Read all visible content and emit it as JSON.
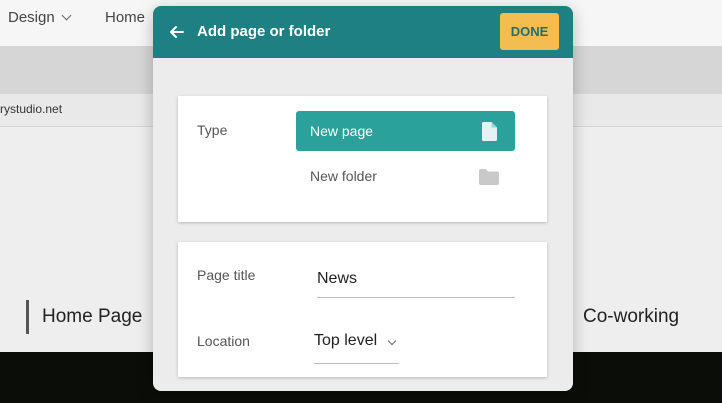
{
  "background": {
    "menu": [
      {
        "label": "Design"
      },
      {
        "label": "Home"
      }
    ],
    "url": "rystudio.net",
    "nav": {
      "home": "Home Page",
      "coworking": "Co-working"
    }
  },
  "dialog": {
    "title": "Add page or folder",
    "done_label": "DONE",
    "type": {
      "label": "Type",
      "options": [
        {
          "label": "New page",
          "selected": true,
          "icon": "page-icon"
        },
        {
          "label": "New folder",
          "selected": false,
          "icon": "folder-icon"
        }
      ]
    },
    "page_title": {
      "label": "Page title",
      "value": "News"
    },
    "location": {
      "label": "Location",
      "value": "Top level"
    }
  },
  "colors": {
    "header": "#1f8083",
    "accent_button": "#f4bd52",
    "selected_option": "#2aa19a"
  }
}
